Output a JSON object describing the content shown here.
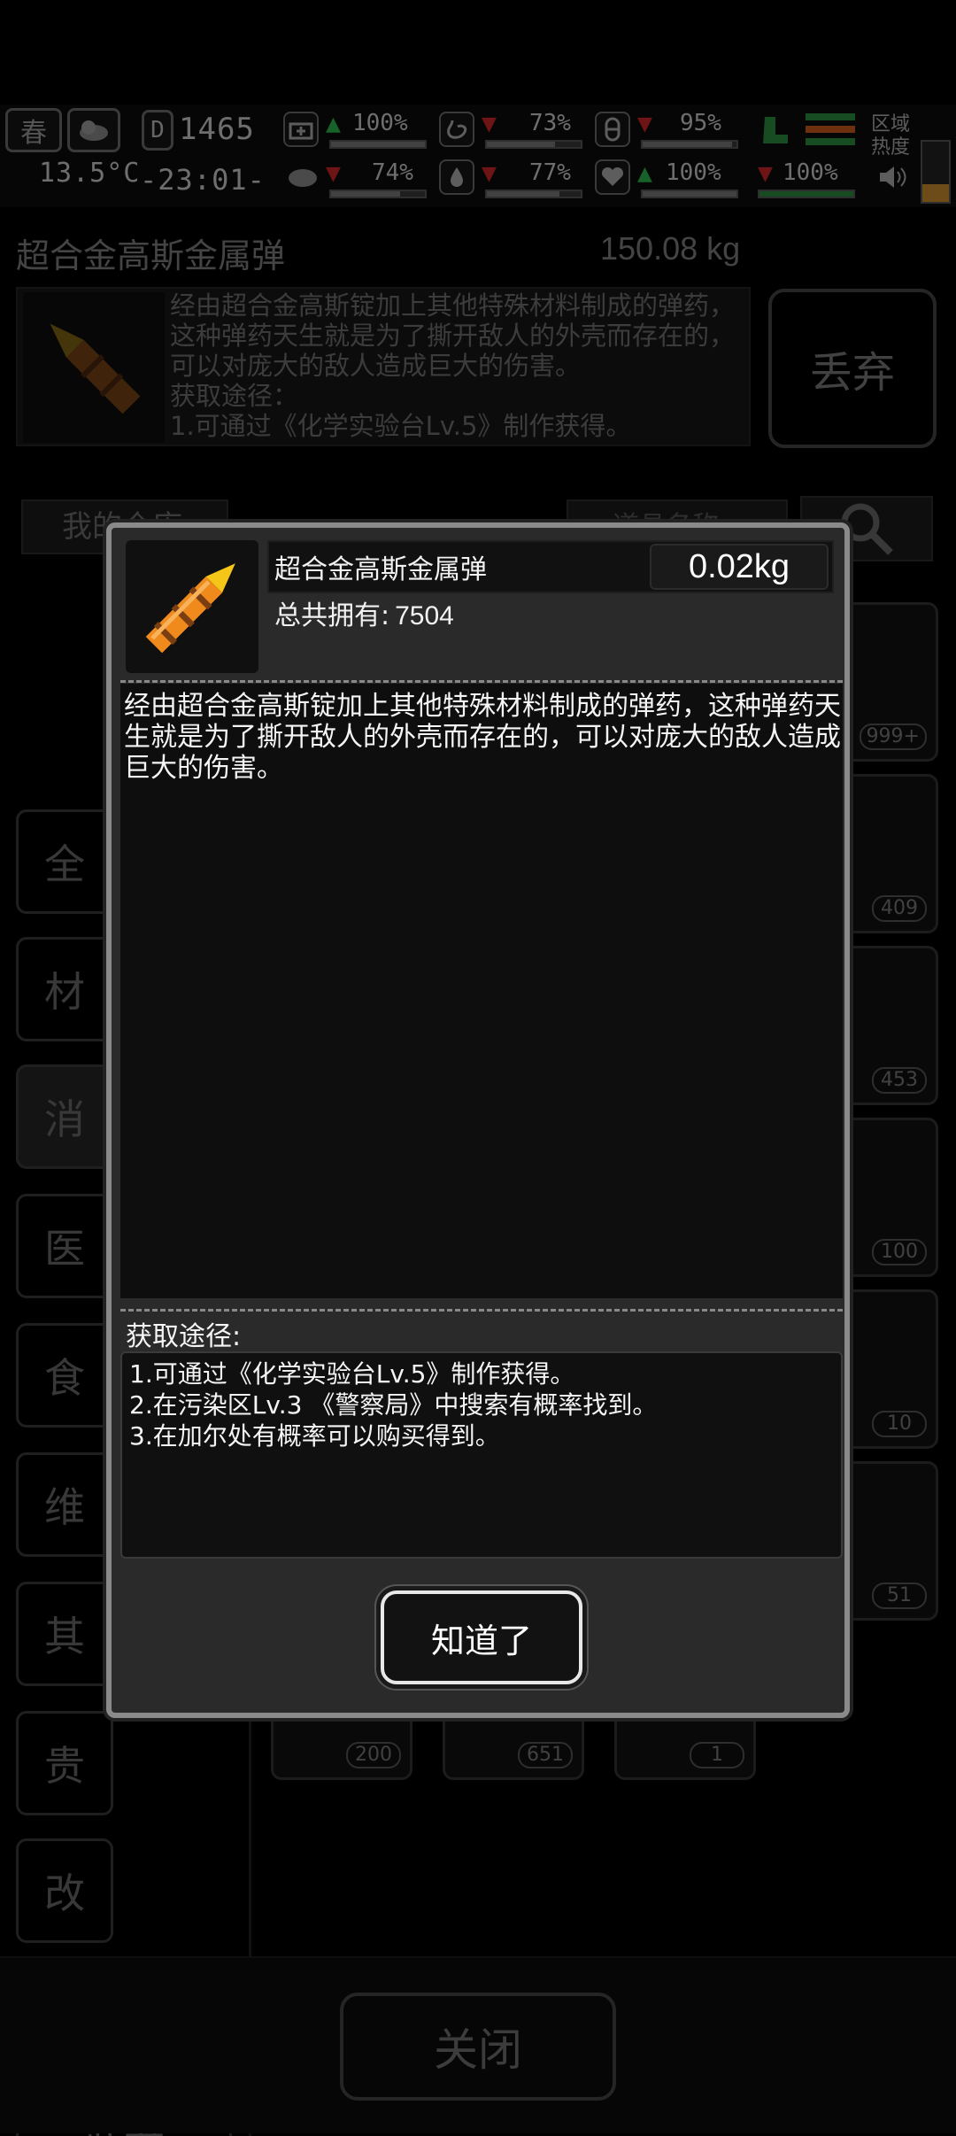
{
  "status": {
    "season": "春",
    "temperature": "13.5°C",
    "day": "1465",
    "clock": "-23:01-",
    "stats": [
      {
        "icon": "medkit-icon",
        "trend": "up",
        "value": "100%"
      },
      {
        "icon": "stomach-icon",
        "trend": "down",
        "value": "73%"
      },
      {
        "icon": "pill-icon",
        "trend": "down",
        "value": "95%"
      },
      {
        "icon": "mood-icon",
        "trend": "down",
        "value": "74%"
      },
      {
        "icon": "water-drop-icon",
        "trend": "down",
        "value": "77%"
      },
      {
        "icon": "heart-icon",
        "trend": "up",
        "value": "100%"
      },
      {
        "icon": "stamina-icon",
        "trend": "down",
        "value": "100%"
      }
    ],
    "zone_heat_label": "区域\n热度"
  },
  "background": {
    "item_title": "超合金高斯金属弹",
    "item_weight": "150.08 kg",
    "item_desc": "经由超合金高斯锭加上其他特殊材料制成的弹药，这种弹药天生就是为了撕开敌人的外壳而存在的，可以对庞大的敌人造成巨大的伤害。",
    "item_source_label": "获取途径：",
    "item_source_1": "1.可通过《化学实验台Lv.5》制作获得。",
    "discard_label": "丢弃",
    "tab_label": "我的仓库",
    "search_placeholder": "道具名称",
    "categories": [
      "全",
      "材",
      "消",
      "医",
      "食",
      "维",
      "其",
      "贵",
      "改",
      "图纸",
      "武器"
    ],
    "slot_counts": [
      "999+",
      "409",
      "453",
      "100",
      "10",
      "51"
    ],
    "bottom_slot_counts": [
      "200",
      "651",
      "1"
    ],
    "close_label": "关闭"
  },
  "modal": {
    "name": "超合金高斯金属弹",
    "weight": "0.02kg",
    "count_label": "总共拥有:",
    "count_value": "7504",
    "description": "经由超合金高斯锭加上其他特殊材料制成的弹药，这种弹药天生就是为了撕开敌人的外壳而存在的，可以对庞大的敌人造成巨大的伤害。",
    "source_label": "获取途径:",
    "sources": [
      "1.可通过《化学实验台Lv.5》制作获得。",
      "2.在污染区Lv.3 《警察局》中搜索有概率找到。",
      "3.在加尔处有概率可以购买得到。"
    ],
    "ok_label": "知道了"
  },
  "colors": {
    "bullet_tip": "#f5c518",
    "bullet_body": "#f08a1c",
    "trend_up": "#2bb34a",
    "trend_down": "#c8262b"
  }
}
